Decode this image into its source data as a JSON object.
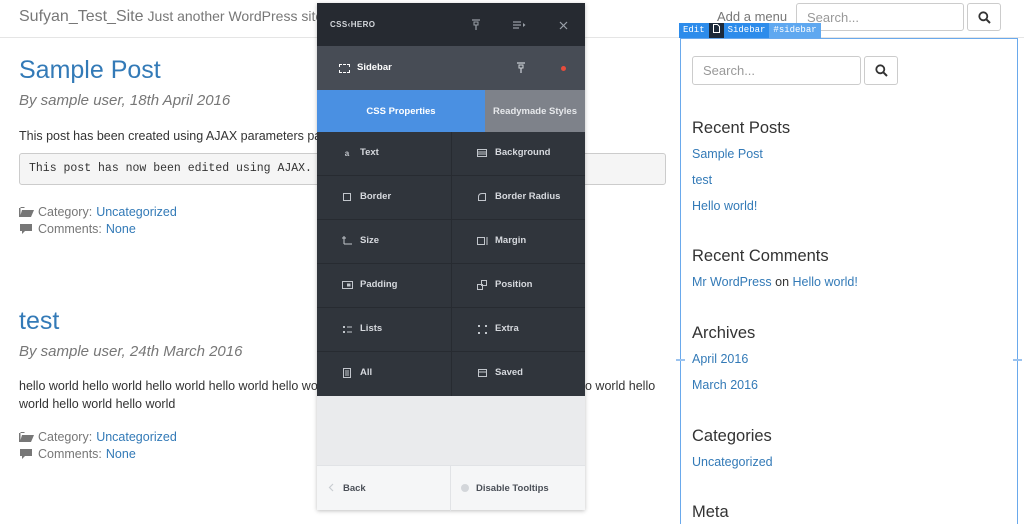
{
  "header": {
    "site_title": "Sufyan_Test_Site",
    "tagline": "Just another WordPress site",
    "menu_link": "Add a menu",
    "search_placeholder": "Search..."
  },
  "posts": [
    {
      "title": "Sample Post",
      "byline": "By sample user, 18th April 2016",
      "text": "This post has been created using AJAX parameters pas",
      "code": "This post has now been edited using AJAX.",
      "category_label": "Category:",
      "category": "Uncategorized",
      "comments_label": "Comments:",
      "comments": "None"
    },
    {
      "title": "test",
      "byline": "By sample user, 24th March 2016",
      "text_line1_left": "hello world hello world hello world hello world hello worl",
      "text_line1_right": "o world hello",
      "text_line2": "world hello world hello world",
      "category_label": "Category:",
      "category": "Uncategorized",
      "comments_label": "Comments:",
      "comments": "None"
    }
  ],
  "sidebar": {
    "tag_edit": "Edit",
    "tag_name": "Sidebar",
    "tag_id": "#sidebar",
    "search_placeholder": "Search...",
    "recent_posts_title": "Recent Posts",
    "recent_posts": [
      "Sample Post",
      "test",
      "Hello world!"
    ],
    "recent_comments_title": "Recent Comments",
    "comment_author": "Mr WordPress",
    "comment_on": "on",
    "comment_post": "Hello world!",
    "archives_title": "Archives",
    "archives": [
      "April 2016",
      "March 2016"
    ],
    "categories_title": "Categories",
    "categories": [
      "Uncategorized"
    ],
    "meta_title": "Meta"
  },
  "csshero": {
    "logo": "CSS‹HERO",
    "selected_element": "Sidebar",
    "tabs": [
      "CSS Properties",
      "Readymade Styles"
    ],
    "properties": [
      {
        "label": "Text",
        "icon": "text-icon"
      },
      {
        "label": "Background",
        "icon": "background-icon"
      },
      {
        "label": "Border",
        "icon": "border-icon"
      },
      {
        "label": "Border Radius",
        "icon": "border-radius-icon"
      },
      {
        "label": "Size",
        "icon": "size-icon"
      },
      {
        "label": "Margin",
        "icon": "margin-icon"
      },
      {
        "label": "Padding",
        "icon": "padding-icon"
      },
      {
        "label": "Position",
        "icon": "position-icon"
      },
      {
        "label": "Lists",
        "icon": "lists-icon"
      },
      {
        "label": "Extra",
        "icon": "extra-icon"
      },
      {
        "label": "All",
        "icon": "all-icon"
      },
      {
        "label": "Saved",
        "icon": "saved-icon"
      }
    ],
    "footer": {
      "back": "Back",
      "tooltips": "Disable Tooltips"
    }
  },
  "colors": {
    "link": "#337ab7",
    "hero_dark": "#30353c",
    "hero_accent": "#4a90e2",
    "selection": "#2d8ceb"
  }
}
